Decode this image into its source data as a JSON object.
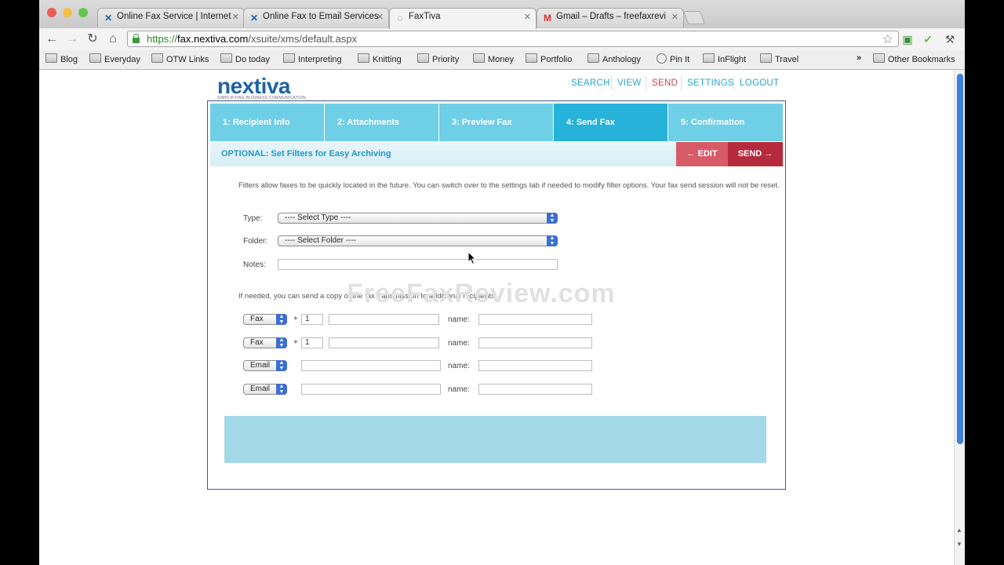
{
  "browser": {
    "tabs": [
      {
        "title": "Online Fax Service | Internet",
        "icon": "nextiva-x-icon"
      },
      {
        "title": "Online Fax to Email Services",
        "icon": "nextiva-x-icon"
      },
      {
        "title": "FaxTiva",
        "icon": "loading-icon"
      },
      {
        "title": "Gmail – Drafts – freefaxrevi",
        "icon": "gmail-icon"
      }
    ],
    "url_scheme": "https://",
    "url_host": "fax.nextiva.com",
    "url_path": "/xsuite/xms/default.aspx",
    "bookmarks": [
      "Blog",
      "Everyday",
      "OTW Links",
      "Do today",
      "Interpreting",
      "Knitting",
      "Priority",
      "Money",
      "Portfolio",
      "Anthology",
      "Pin It",
      "InFlight",
      "Travel"
    ],
    "overflow": "»",
    "other_bookmarks": "Other Bookmarks"
  },
  "site": {
    "logo_text": "nextiva",
    "logo_tagline": "SIMPLIFYING BUSINESS COMMUNICATION",
    "nav": [
      "SEARCH",
      "VIEW",
      "SEND",
      "SETTINGS",
      "LOGOUT"
    ],
    "nav_selected": "SEND"
  },
  "wizard": {
    "steps": [
      "1: Recipient Info",
      "2: Attachments",
      "3: Preview Fax",
      "4: Send Fax",
      "5: Confirmation"
    ],
    "current_step": "4: Send Fax",
    "subtitle": "OPTIONAL: Set Filters for Easy Archiving",
    "edit_label": "EDIT",
    "send_label": "SEND"
  },
  "form": {
    "intro": "Filters allow faxes to be quickly located in the future. You can switch over to the settings tab if needed to modify filter options. Your fax send session will not be reset.",
    "type_label": "Type:",
    "type_value": "---- Select Type ----",
    "folder_label": "Folder:",
    "folder_value": "---- Select Folder ----",
    "notes_label": "Notes:",
    "notes_value": "",
    "copy_text": "If needed, you can send a copy of the fax transmission to additional recipients:",
    "name_label": "name:",
    "plus": "+",
    "recipients": [
      {
        "kind": "Fax",
        "country_code": "1",
        "number": "",
        "name": ""
      },
      {
        "kind": "Fax",
        "country_code": "1",
        "number": "",
        "name": ""
      },
      {
        "kind": "Email",
        "address": "",
        "name": ""
      },
      {
        "kind": "Email",
        "address": "",
        "name": ""
      }
    ]
  },
  "watermark": "FreeFaxReview.com",
  "colors": {
    "step_bg": "#6fcfe6",
    "step_current": "#26b2d9",
    "edit_button": "#d75a68",
    "send_button": "#b52a3c",
    "brand_blue": "#1d62a8",
    "nav_link": "#2ba6c9"
  }
}
